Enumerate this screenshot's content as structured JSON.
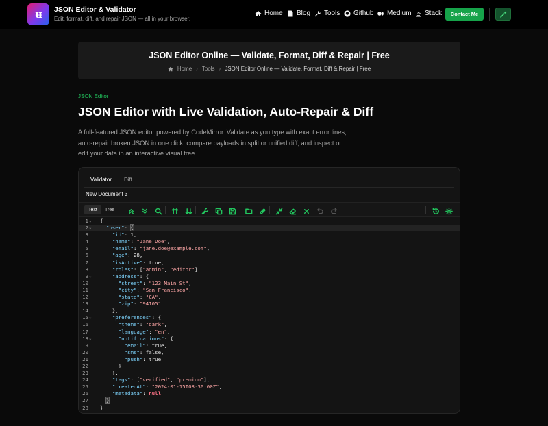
{
  "header": {
    "logo_text": "ᵼᵻ",
    "title": "JSON Editor & Validator",
    "subtitle": "Edit, format, diff, and repair JSON — all in your browser.",
    "nav": [
      {
        "label": "Home",
        "icon": "home-icon"
      },
      {
        "label": "Blog",
        "icon": "document-icon"
      },
      {
        "label": "Tools",
        "icon": "wrench-icon"
      },
      {
        "label": "Github",
        "icon": "github-icon"
      },
      {
        "label": "Medium",
        "icon": "medium-icon"
      },
      {
        "label": "Stack",
        "icon": "stack-icon"
      }
    ],
    "contact_label": "Contact Me",
    "theme_icon": "magic-wand-icon",
    "accent": "#16a34a"
  },
  "page": {
    "title": "JSON Editor Online — Validate, Format, Diff & Repair | Free",
    "breadcrumb": [
      "Home",
      "Tools",
      "JSON Editor Online — Validate, Format, Diff & Repair | Free"
    ],
    "eyebrow": "JSON Editor",
    "heading": "JSON Editor with Live Validation, Auto-Repair & Diff",
    "description": "A full-featured JSON editor powered by CodeMirror. Validate as you type with exact error lines, auto-repair broken JSON in one click, compare payloads in split or unified diff, and inspect or edit your data in an interactive visual tree."
  },
  "editor": {
    "tabs": [
      "Validator",
      "Diff"
    ],
    "active_tab": "Validator",
    "document_name": "New Document 3",
    "modes": [
      "Text",
      "Tree"
    ],
    "active_mode": "Text"
  }
}
